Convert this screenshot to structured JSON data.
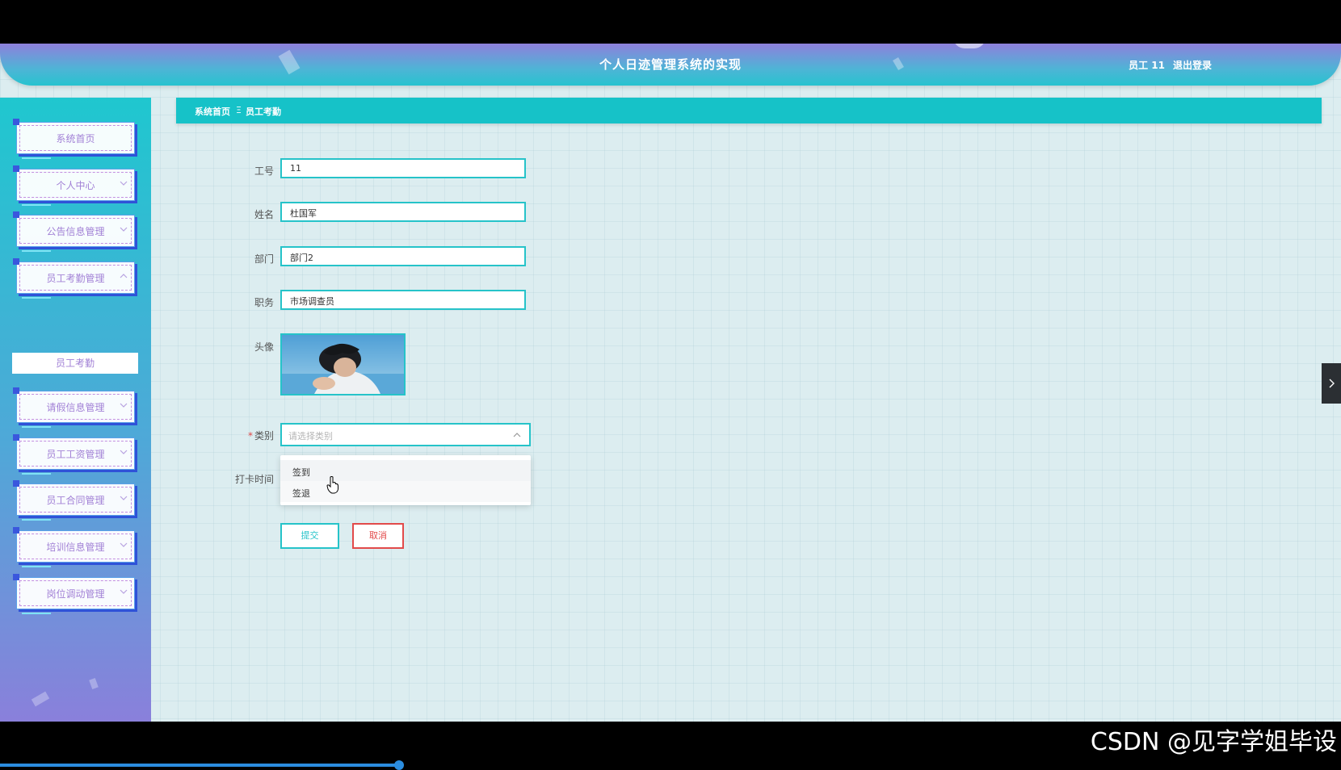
{
  "header": {
    "title": "个人日迹管理系统的实现",
    "user": "员工 11",
    "logout": "退出登录"
  },
  "sidebar": {
    "items": [
      {
        "label": "系统首页"
      },
      {
        "label": "个人中心"
      },
      {
        "label": "公告信息管理"
      },
      {
        "label": "员工考勤管理"
      },
      {
        "label": "请假信息管理"
      },
      {
        "label": "员工工资管理"
      },
      {
        "label": "员工合同管理"
      },
      {
        "label": "培训信息管理"
      },
      {
        "label": "岗位调动管理"
      }
    ],
    "subitem": "员工考勤"
  },
  "breadcrumb": {
    "home": "系统首页",
    "separator": "Ξ",
    "current": "员工考勤"
  },
  "form": {
    "employee_id": {
      "label": "工号",
      "value": "11"
    },
    "name": {
      "label": "姓名",
      "value": "杜国军"
    },
    "department": {
      "label": "部门",
      "value": "部门2"
    },
    "position": {
      "label": "职务",
      "value": "市场调查员"
    },
    "avatar": {
      "label": "头像"
    },
    "category": {
      "required_mark": "*",
      "label": "类别",
      "placeholder": "请选择类别"
    },
    "punch_time": {
      "label": "打卡时间"
    },
    "options": [
      "签到",
      "签退"
    ],
    "submit_label": "提交",
    "cancel_label": "取消"
  },
  "watermark": "CSDN @见字学姐毕设",
  "colors": {
    "accent": "#26c3c9",
    "danger": "#e24a4a",
    "menu_text": "#a281d6"
  }
}
